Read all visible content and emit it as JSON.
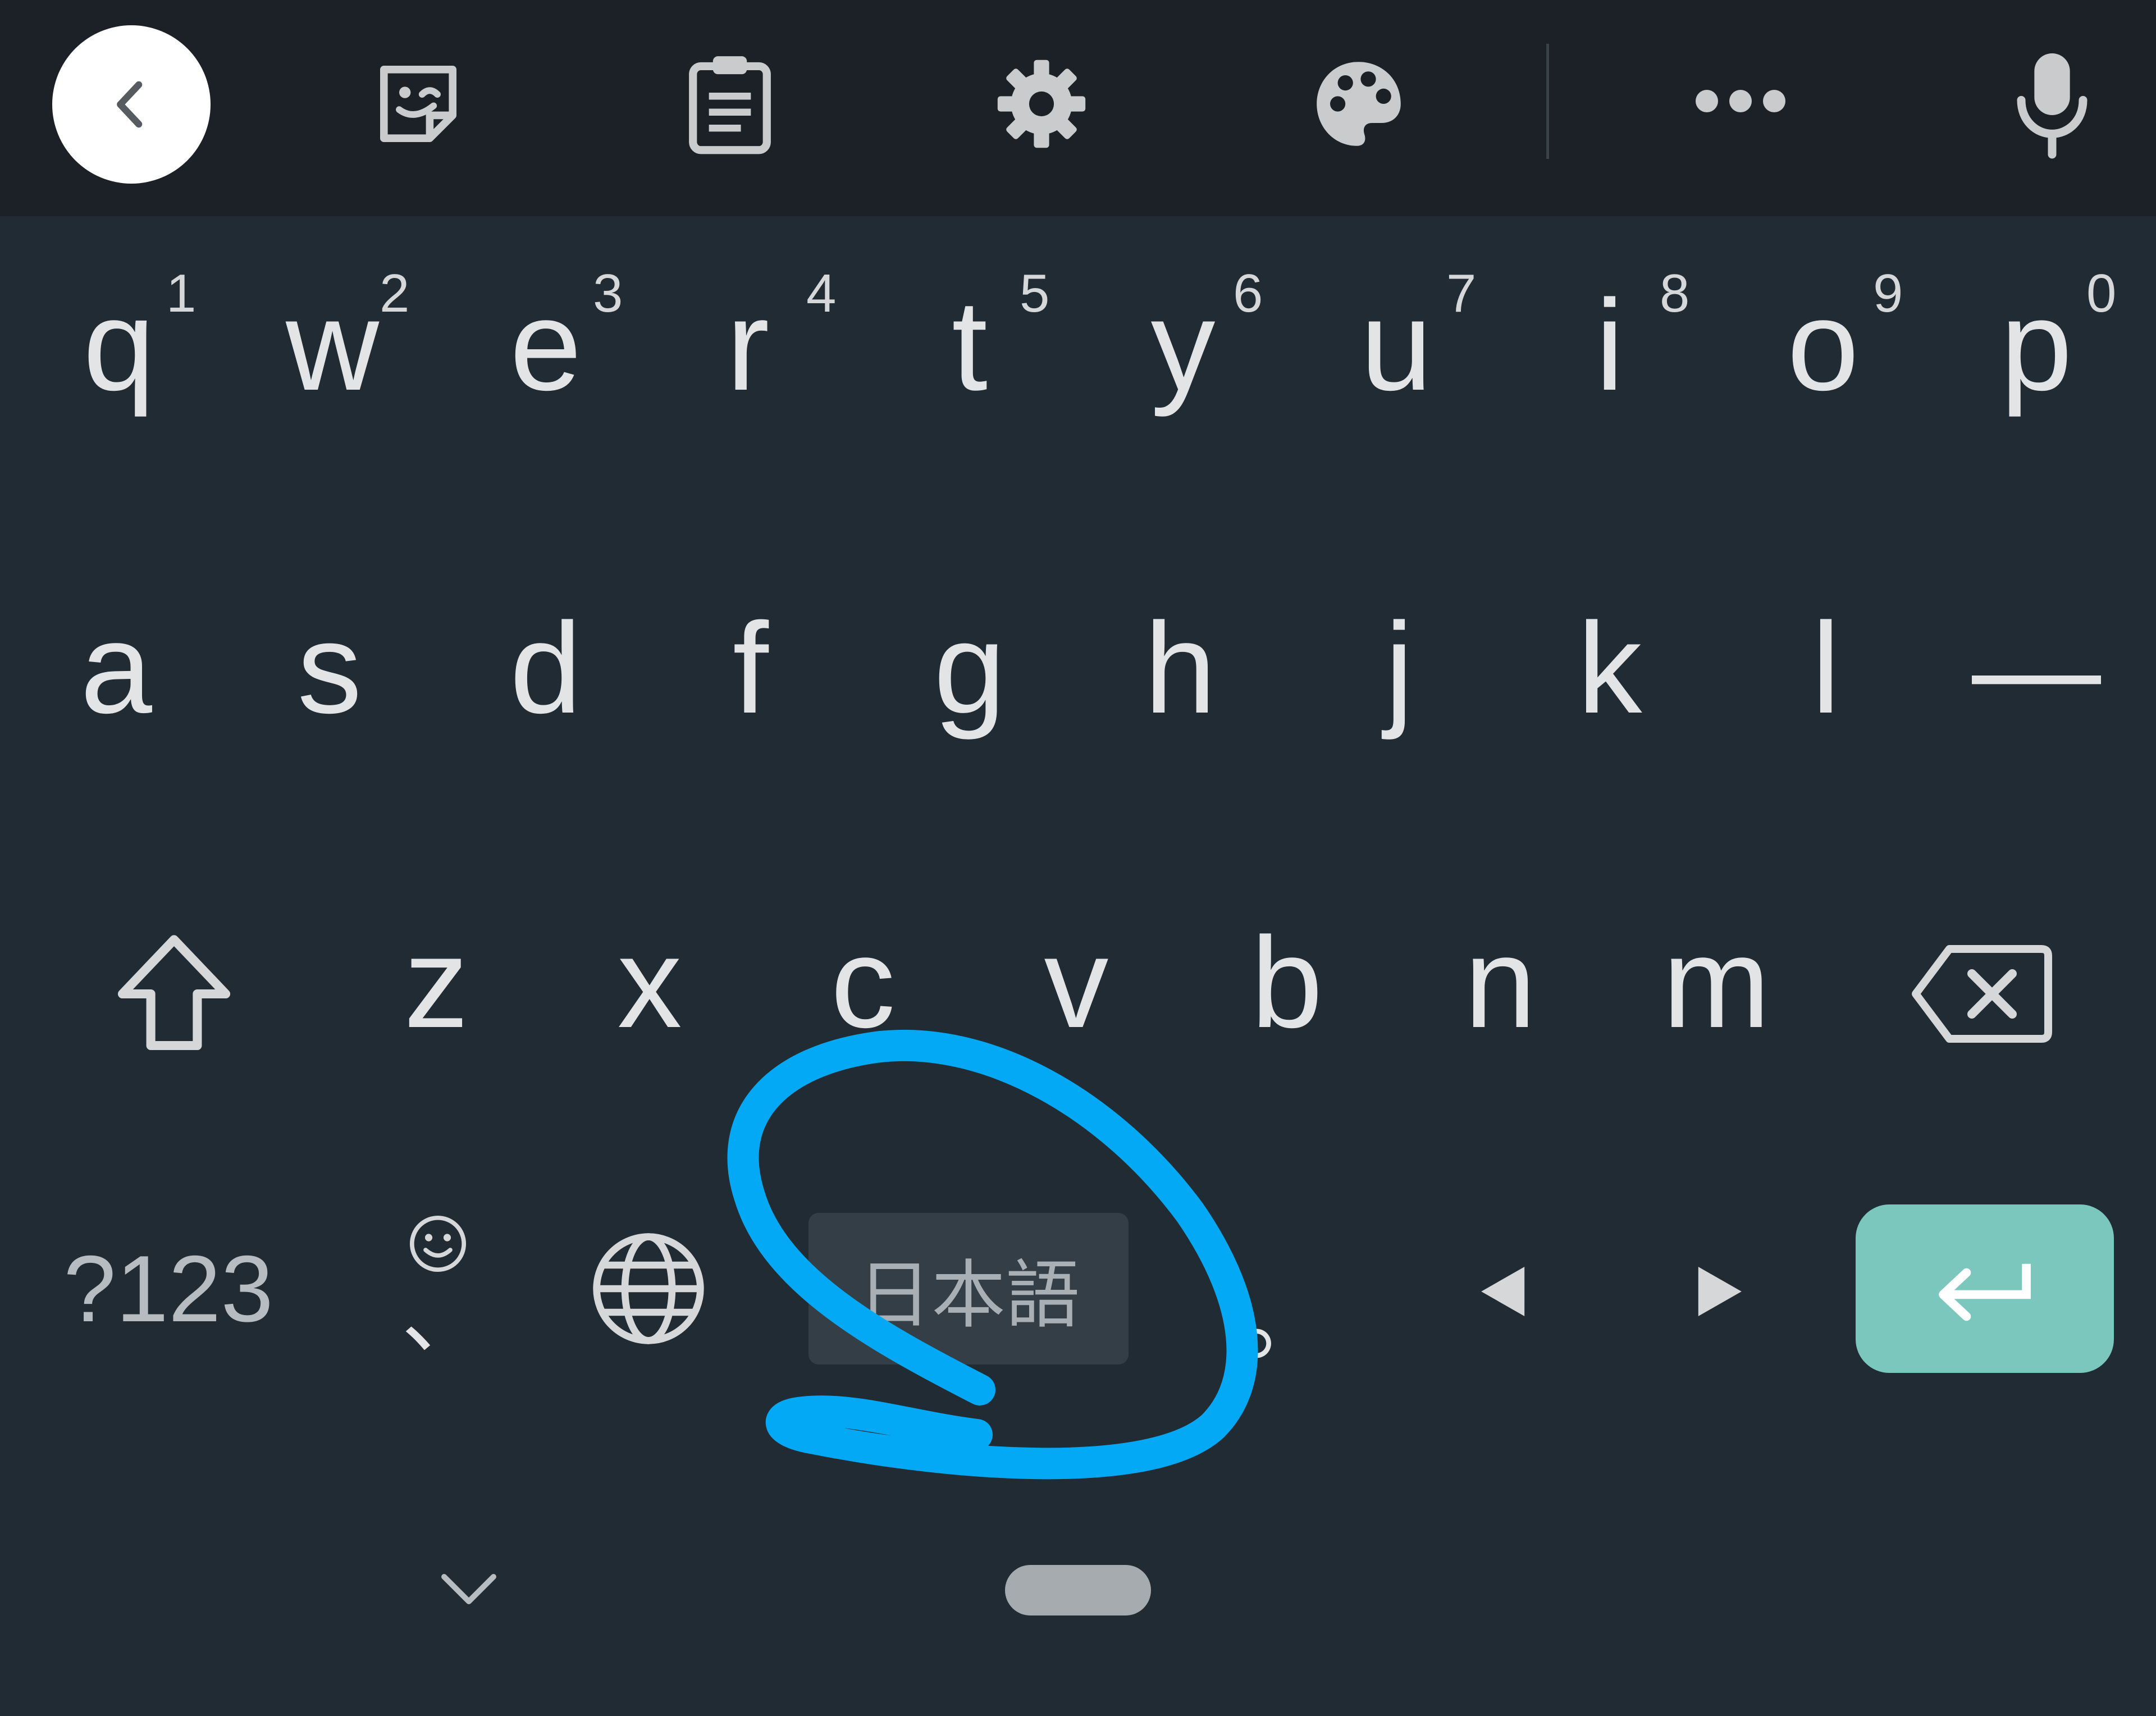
{
  "toolbar": {
    "icons": [
      "back-icon",
      "sticker-icon",
      "clipboard-icon",
      "gear-icon",
      "palette-icon",
      "more-icon",
      "microphone-icon"
    ]
  },
  "keyboard": {
    "row1": [
      {
        "letter": "q",
        "hint": "1"
      },
      {
        "letter": "w",
        "hint": "2"
      },
      {
        "letter": "e",
        "hint": "3"
      },
      {
        "letter": "r",
        "hint": "4"
      },
      {
        "letter": "t",
        "hint": "5"
      },
      {
        "letter": "y",
        "hint": "6"
      },
      {
        "letter": "u",
        "hint": "7"
      },
      {
        "letter": "i",
        "hint": "8"
      },
      {
        "letter": "o",
        "hint": "9"
      },
      {
        "letter": "p",
        "hint": "0"
      }
    ],
    "row2": [
      "a",
      "s",
      "d",
      "f",
      "g",
      "h",
      "j",
      "k",
      "l",
      "—"
    ],
    "row3": [
      "z",
      "x",
      "c",
      "v",
      "b",
      "n",
      "m"
    ],
    "bottom": {
      "symbols_label": "?123",
      "comma_label": "、",
      "language_label": "日本語",
      "period_label": "。"
    },
    "colors": {
      "background": "#202b33",
      "toolbar": "#1b2126",
      "enter_key": "#7cc7bd",
      "annotation": "#03a9f4"
    }
  }
}
